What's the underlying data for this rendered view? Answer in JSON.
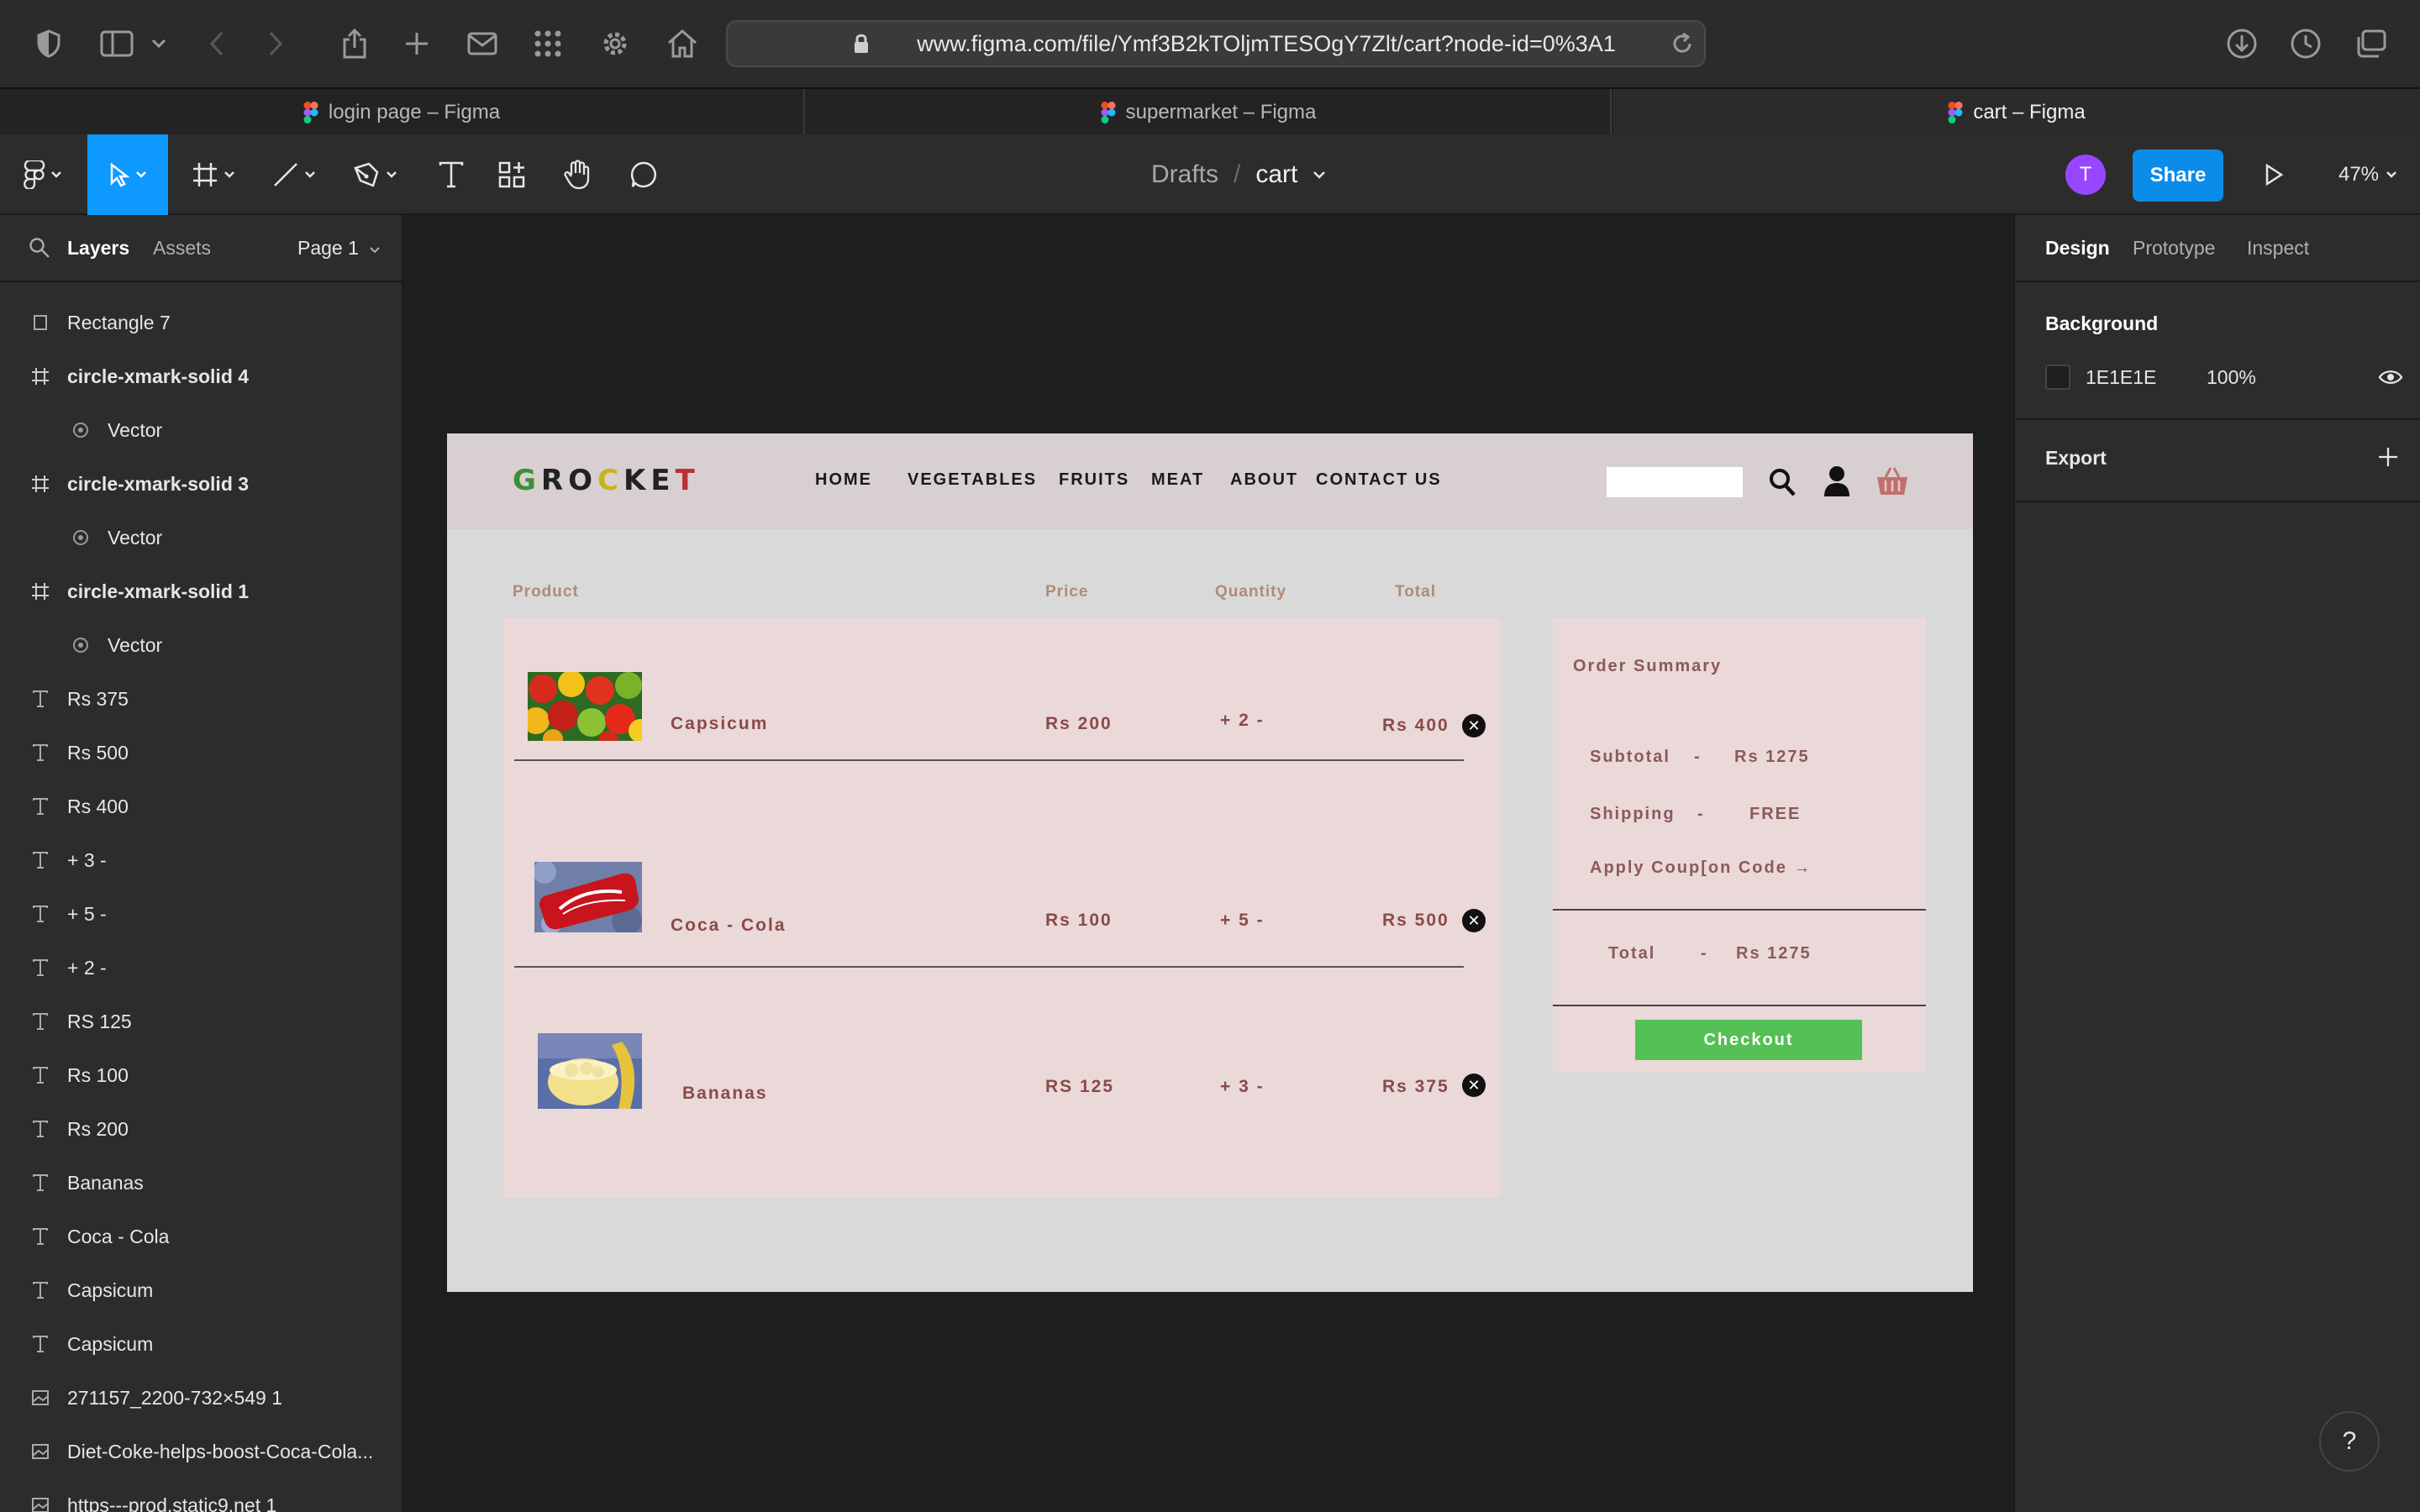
{
  "browser": {
    "url": "www.figma.com/file/Ymf3B2kTOljmTESOgY7Zlt/cart?node-id=0%3A1",
    "tabs": [
      {
        "label": "login page – Figma",
        "active": false
      },
      {
        "label": "supermarket – Figma",
        "active": false
      },
      {
        "label": "cart – Figma",
        "active": true
      }
    ]
  },
  "toolbar": {
    "breadcrumb_parent": "Drafts",
    "breadcrumb_sep": "/",
    "file_name": "cart",
    "avatar_initial": "T",
    "share_label": "Share",
    "zoom": "47%"
  },
  "left_panel": {
    "tabs": [
      "Layers",
      "Assets"
    ],
    "page": "Page 1",
    "layers": [
      {
        "name": "Rectangle 7",
        "type": "rect"
      },
      {
        "name": "circle-xmark-solid 4",
        "type": "frame"
      },
      {
        "name": "Vector",
        "type": "vector"
      },
      {
        "name": "circle-xmark-solid 3",
        "type": "frame"
      },
      {
        "name": "Vector",
        "type": "vector"
      },
      {
        "name": "circle-xmark-solid 1",
        "type": "frame"
      },
      {
        "name": "Vector",
        "type": "vector"
      },
      {
        "name": "Rs 375",
        "type": "text"
      },
      {
        "name": "Rs 500",
        "type": "text"
      },
      {
        "name": "Rs 400",
        "type": "text"
      },
      {
        "name": "+ 3 -",
        "type": "text"
      },
      {
        "name": "+ 5 -",
        "type": "text"
      },
      {
        "name": "+ 2 -",
        "type": "text"
      },
      {
        "name": "RS 125",
        "type": "text"
      },
      {
        "name": "Rs 100",
        "type": "text"
      },
      {
        "name": "Rs 200",
        "type": "text"
      },
      {
        "name": "Bananas",
        "type": "text"
      },
      {
        "name": "Coca - Cola",
        "type": "text"
      },
      {
        "name": "Capsicum",
        "type": "text"
      },
      {
        "name": "Capsicum",
        "type": "text"
      },
      {
        "name": "271157_2200-732×549 1",
        "type": "image"
      },
      {
        "name": "Diet-Coke-helps-boost-Coca-Cola...",
        "type": "image"
      },
      {
        "name": "https---prod.static9.net 1",
        "type": "image"
      }
    ]
  },
  "right_panel": {
    "tabs": [
      "Design",
      "Prototype",
      "Inspect"
    ],
    "background_label": "Background",
    "bg_hex": "1E1E1E",
    "bg_opacity": "100%",
    "export_label": "Export"
  },
  "site": {
    "logo_letters": [
      "G",
      "R",
      "O",
      "C",
      "K",
      "E",
      "T"
    ],
    "logo_colors": [
      "#3a8f3a",
      "#222222",
      "#222222",
      "#c9b21a",
      "#222222",
      "#222222",
      "#b83232"
    ],
    "nav": [
      "HOME",
      "VEGETABLES",
      "FRUITS",
      "MEAT",
      "ABOUT",
      "CONTACT US"
    ],
    "columns": {
      "product": "Product",
      "price": "Price",
      "quantity": "Quantity",
      "total": "Total"
    },
    "items": [
      {
        "name": "Capsicum",
        "price": "Rs 200",
        "qty": "+ 2 -",
        "total": "Rs 400"
      },
      {
        "name": "Coca - Cola",
        "price": "Rs 100",
        "qty": "+ 5 -",
        "total": "Rs 500"
      },
      {
        "name": "Bananas",
        "price": "RS 125",
        "qty": "+ 3 -",
        "total": "Rs 375"
      }
    ],
    "summary": {
      "title": "Order Summary",
      "subtotal_label": "Subtotal",
      "subtotal_value": "Rs 1275",
      "shipping_label": "Shipping",
      "shipping_value": "FREE",
      "coupon": "Apply Coup[on Code →",
      "total_label": "Total",
      "total_value": "Rs 1275",
      "dash": "-",
      "checkout": "Checkout"
    }
  },
  "help": "?"
}
